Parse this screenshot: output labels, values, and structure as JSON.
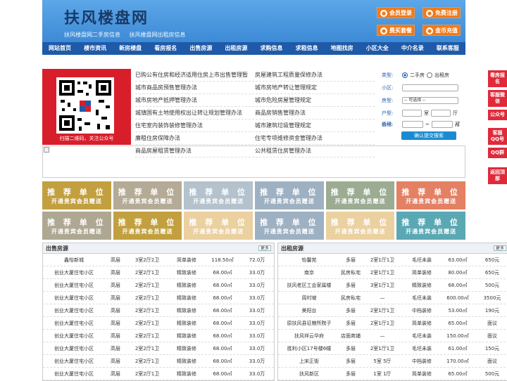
{
  "header": {
    "title": "扶风楼盘网",
    "subtitle_links": [
      "扶风楼盘网二手房信息",
      "扶风楼盘网出租房信息"
    ],
    "buttons": [
      "会员登录",
      "免费注册",
      "费买套餐",
      "金币充值"
    ]
  },
  "nav": [
    "网站首页",
    "楼市资讯",
    "新房楼盘",
    "看房报名",
    "出售房源",
    "出租房源",
    "求购信息",
    "求租信息",
    "地图找房",
    "小区大全",
    "中介名录",
    "联系客服"
  ],
  "qr": {
    "caption": "扫描二维码，关注公众号"
  },
  "policy_links": [
    [
      "已购公有住房和经济适用住房上市出售管理暂",
      "房屋建筑工程质量保修办法"
    ],
    [
      "城市商品房预售管理办法",
      "城市房地产转让管理规定"
    ],
    [
      "城市房地产抵押管理办法",
      "城市危险房屋管理规定"
    ],
    [
      "城镇国有土地使用权出让转让规划管理办法",
      "商品房销售管理办法"
    ],
    [
      "住宅室内装饰装修管理办法",
      "城市建筑垃圾管理规定"
    ],
    [
      "廉租住房保障办法",
      "住宅专项维修资金管理办法"
    ],
    [
      "商品房屋租赁管理办法",
      "公共租赁住房管理办法"
    ]
  ],
  "search": {
    "type_label": "类型:",
    "type_opt1": "二手房",
    "type_opt2": "出租房",
    "community_label": "小区:",
    "room_label": "房型:",
    "room_select": "-- 可选择 --",
    "layout_label": "户型:",
    "shi": "室",
    "ting": "厅",
    "area_label": "面积:",
    "area_unit": "㎡",
    "price_label": "价格:",
    "price_unit": "万",
    "submit": "确认提交搜索"
  },
  "tiles": {
    "title": "推 荐 单 位",
    "sub": "开通贵宾会员赠送",
    "colors": [
      "#b8901e",
      "#a89c84",
      "#a6b8c4",
      "#8ea4b8",
      "#8a9e80",
      "#e06a48",
      "#a09880",
      "#b8901e",
      "#e8c890",
      "#8ea4b8",
      "#e8c890",
      "#3e9aa8"
    ]
  },
  "sale": {
    "title": "出售房源",
    "more": "更多",
    "rows": [
      [
        "鑫怡新城",
        "高层",
        "3室2厅2卫",
        "简单装修",
        "118.50㎡",
        "72.0万"
      ],
      [
        "创业大厦住宅小区",
        "高层",
        "2室2厅1卫",
        "精致装修",
        "68.00㎡",
        "33.0万"
      ],
      [
        "创业大厦住宅小区",
        "高层",
        "2室2厅1卫",
        "精致装修",
        "68.00㎡",
        "33.0万"
      ],
      [
        "创业大厦住宅小区",
        "高层",
        "2室2厅1卫",
        "精致装修",
        "68.00㎡",
        "33.0万"
      ],
      [
        "创业大厦住宅小区",
        "高层",
        "2室2厅1卫",
        "精致装修",
        "68.00㎡",
        "33.0万"
      ],
      [
        "创业大厦住宅小区",
        "高层",
        "2室2厅1卫",
        "精致装修",
        "68.00㎡",
        "33.0万"
      ],
      [
        "创业大厦住宅小区",
        "高层",
        "2室2厅1卫",
        "精致装修",
        "68.00㎡",
        "33.0万"
      ],
      [
        "创业大厦住宅小区",
        "高层",
        "2室2厅1卫",
        "精致装修",
        "68.00㎡",
        "33.0万"
      ],
      [
        "创业大厦住宅小区",
        "高层",
        "2室2厅1卫",
        "精致装修",
        "68.00㎡",
        "33.0万"
      ],
      [
        "创业大厦住宅小区",
        "高层",
        "2室2厅1卫",
        "精致装修",
        "68.00㎡",
        "33.0万"
      ]
    ]
  },
  "rent": {
    "title": "出租房源",
    "more": "更多",
    "rows": [
      [
        "怡馨苑",
        "多层",
        "2室1厅1卫",
        "毛坯未装",
        "63.00㎡",
        "650元"
      ],
      [
        "南京",
        "民房私宅",
        "2室1厅1卫",
        "简单装修",
        "80.00㎡",
        "650元"
      ],
      [
        "扶风老区工会家属楼",
        "多层",
        "3室1厅1卫",
        "精致装修",
        "68.00㎡",
        "500元"
      ],
      [
        "周村坡",
        "民房私宅",
        "—",
        "毛坯未装",
        "600.00㎡",
        "3500元"
      ],
      [
        "美阳台",
        "多层",
        "2室1厅1卫",
        "中档装修",
        "53.00㎡",
        "190元"
      ],
      [
        "原扶风县征粮所院子",
        "多层",
        "2室1厅1卫",
        "简单装修",
        "65.00㎡",
        "面议"
      ],
      [
        "扶风祥云华府",
        "店面商铺",
        "—",
        "毛坯未装",
        "150.00㎡",
        "面议"
      ],
      [
        "胜利小区17号楼6幢",
        "多层",
        "2室1厅1卫",
        "毛坯未装",
        "61.00㎡",
        "150元"
      ],
      [
        "上宋正街",
        "多层",
        "5室 5厅",
        "中档装修",
        "170.00㎡",
        "面议"
      ],
      [
        "扶风新区",
        "多层",
        "1室 1厅",
        "简单装修",
        "65.00㎡",
        "500元"
      ]
    ]
  },
  "side": [
    "看房报名",
    "客服微信",
    "公众号",
    "客服QQ号",
    "QQ群",
    "返回顶部"
  ]
}
